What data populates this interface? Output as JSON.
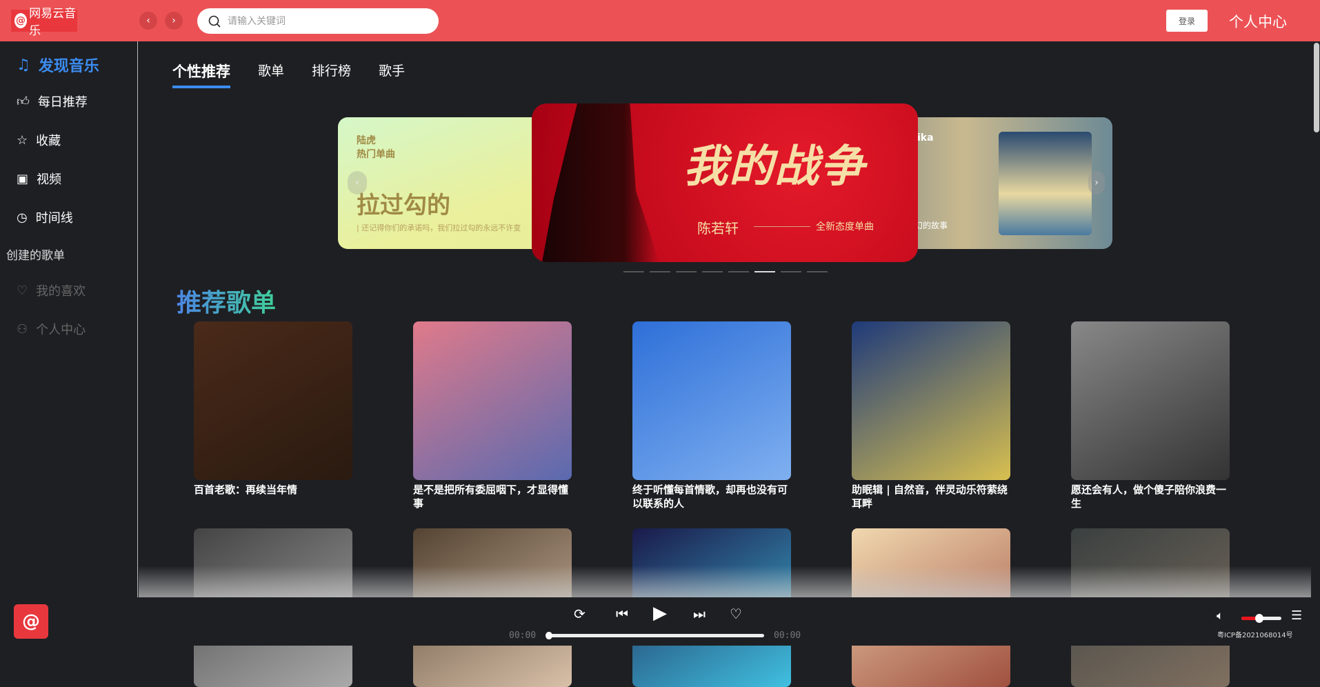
{
  "header": {
    "logo_text": "网易云音乐",
    "search_placeholder": "请输入关键词",
    "login": "登录",
    "user_center": "个人中心"
  },
  "sidebar": {
    "items": [
      {
        "label": "发现音乐",
        "icon": "music-note-icon"
      },
      {
        "label": "每日推荐",
        "icon": "thumbs-up-icon"
      },
      {
        "label": "收藏",
        "icon": "star-icon"
      },
      {
        "label": "视频",
        "icon": "video-icon"
      },
      {
        "label": "时间线",
        "icon": "clock-icon"
      }
    ],
    "group_title": "创建的歌单",
    "group_items": [
      {
        "label": "我的喜欢",
        "icon": "heart-icon"
      },
      {
        "label": "个人中心",
        "icon": "user-icon"
      }
    ]
  },
  "tabs": [
    "个性推荐",
    "歌单",
    "排行榜",
    "歌手"
  ],
  "banner": {
    "left": {
      "artist": "陆虎",
      "tag": "热门单曲",
      "title": "拉过勾的",
      "subtitle": "| 还记得你们的承诺吗，我们拉过勾的永远不许变"
    },
    "center": {
      "title": "我的战争",
      "artist": "陈若轩",
      "tag": "全新态度单曲"
    },
    "right": {
      "artist": "ika",
      "subtitle": "讲变幻的故事"
    },
    "dots": 8,
    "active_dot": 6
  },
  "section_title": "推荐歌单",
  "playlists": [
    {
      "title": "百首老歌：再续当年情",
      "colors": [
        "#4a2a1a",
        "#2a1a10"
      ]
    },
    {
      "title": "是不是把所有委屈咽下，才显得懂事",
      "colors": [
        "#e07a8a",
        "#5a6ab0"
      ]
    },
    {
      "title": "终于听懂每首情歌，却再也没有可以联系的人",
      "colors": [
        "#2e6fd8",
        "#7fb0f0"
      ]
    },
    {
      "title": "助眠辑 | 自然音，伴灵动乐符萦绕耳畔",
      "colors": [
        "#1e3a7a",
        "#d8c050"
      ]
    },
    {
      "title": "愿还会有人，做个傻子陪你浪费一生",
      "colors": [
        "#888",
        "#333"
      ]
    },
    {
      "colors": [
        "#444",
        "#aaa"
      ]
    },
    {
      "colors": [
        "#554433",
        "#d8c0a8"
      ]
    },
    {
      "colors": [
        "#1a1a4a",
        "#40c0e0"
      ]
    },
    {
      "colors": [
        "#f0d8b0",
        "#a05040"
      ]
    },
    {
      "colors": [
        "#3a4040",
        "#807060"
      ]
    }
  ],
  "player": {
    "current_time": "00:00",
    "total_time": "00:00",
    "progress": 0,
    "volume": 0.45,
    "icp": "粤ICP备2021068014号"
  },
  "colors": {
    "header": "#ec5255",
    "accent": "#3b8cf0",
    "background": "#1e1f23"
  }
}
